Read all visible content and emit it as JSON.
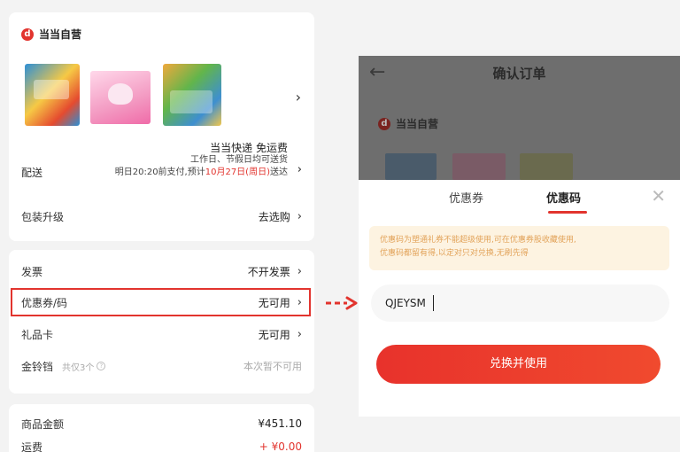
{
  "left": {
    "store_name": "当当自营",
    "store_badge_char": "d",
    "delivery": {
      "label": "配送",
      "main": "当当快递 免运费",
      "line1": "工作日、节假日均可送货",
      "line2_prefix": "明日20:20前支付,预计",
      "line2_highlight": "10月27日(周日)",
      "line2_suffix": "送达"
    },
    "packaging": {
      "label": "包装升级",
      "value": "去选购"
    },
    "invoice": {
      "label": "发票",
      "value": "不开发票"
    },
    "coupon": {
      "label": "优惠券/码",
      "value": "无可用"
    },
    "gift_card": {
      "label": "礼品卡",
      "value": "无可用"
    },
    "gold_coin": {
      "label": "金铃铛",
      "sub": "共仅3个",
      "value": "本次暂不可用"
    },
    "summary": {
      "goods_label": "商品金额",
      "goods_value": "¥451.10",
      "ship_label": "运费",
      "ship_value": "+ ¥0.00"
    }
  },
  "right": {
    "header_title": "确认订单",
    "back_icon": "←",
    "store_name": "当当自营",
    "tabs": [
      "优惠券",
      "优惠码"
    ],
    "active_tab": "优惠码",
    "close_icon": "✕",
    "notice_line1": "优惠码为塑通礼券不能超级使用,可在优惠券股收藏使用,",
    "notice_line2": "优惠码都留有得,以定对只对兑换,无刷先得",
    "code_value": "QJEYSM",
    "apply_label": "兑换并使用"
  },
  "colors": {
    "accent": "#e2342e",
    "notice_bg": "#fdf3e1",
    "notice_text": "#e2a35a"
  }
}
